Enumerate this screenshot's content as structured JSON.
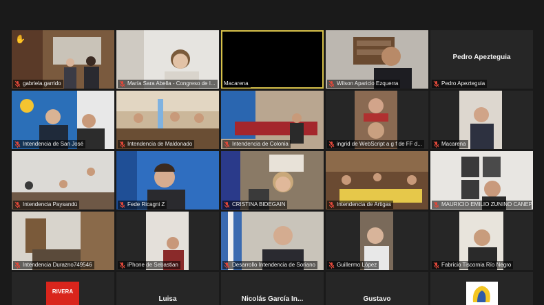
{
  "participants": [
    {
      "name": "gabriela.garrido",
      "raised_hand": "✋",
      "scene": "office-two"
    },
    {
      "name": "María Sara Abella - Congreso de I...",
      "scene": "woman-glasses"
    },
    {
      "name": "Macarena",
      "scene": "black",
      "speaking": true
    },
    {
      "name": "Wilson Aparicio Ezquerra",
      "scene": "man-bookshelf"
    },
    {
      "name": "Pedro Apezteguia",
      "display_name": "Pedro Apezteguia",
      "scene": "no-video"
    },
    {
      "name": "Intendencia  de San José",
      "scene": "two-men-blue"
    },
    {
      "name": "Intendencia de Maldonado",
      "scene": "meeting-room"
    },
    {
      "name": "Intendencia de Colonia",
      "scene": "red-chairs"
    },
    {
      "name": "ingrid de WebScript  a g f de FF  d...",
      "scene": "two-women"
    },
    {
      "name": "Macarena",
      "scene": "woman-office"
    },
    {
      "name": "Intendencia Paysandú",
      "scene": "paysandu-room"
    },
    {
      "name": "Fede Ricagni Z",
      "scene": "young-man"
    },
    {
      "name": "CRISTINA BIDEGAIN",
      "scene": "woman-flag"
    },
    {
      "name": "Intendencia de Artigas",
      "scene": "table-yellow"
    },
    {
      "name": "MAURICIO EMILIO ZUNINO CANEPA",
      "scene": "portraits"
    },
    {
      "name": "Intendencia Durazno749546",
      "scene": "white-office"
    },
    {
      "name": "iPhone de Sebastian",
      "scene": "man-small"
    },
    {
      "name": "Desarrollo Intendencia de Soriano",
      "scene": "man-glasses-flag"
    },
    {
      "name": "Guillermo López",
      "scene": "man-phone"
    },
    {
      "name": "Fabricio Tiscornia Río Negro",
      "scene": "man-dark-shirt"
    }
  ],
  "bottom_tiles": [
    {
      "display_name": "",
      "logo": "rivera",
      "logo_text": "RIVERA"
    },
    {
      "display_name": "Luisa"
    },
    {
      "display_name": "Nicolás García In..."
    },
    {
      "display_name": "Gustavo"
    },
    {
      "display_name": "",
      "logo": "yellow"
    }
  ],
  "colors": {
    "speaking_border": "#d8c24a",
    "mic_muted": "#e0483a",
    "tile_bg": "#262626",
    "page_bg": "#1a1a1a"
  }
}
